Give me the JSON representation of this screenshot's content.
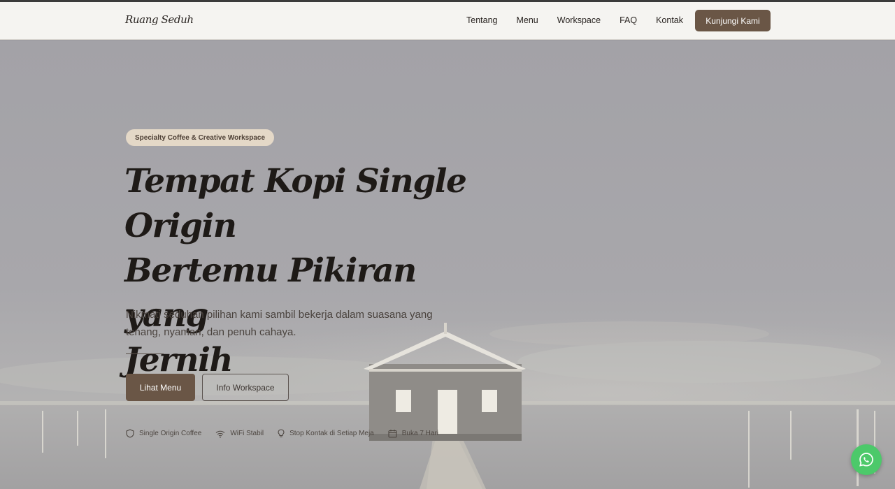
{
  "brand": "Ruang Seduh",
  "nav": {
    "items": [
      "Tentang",
      "Menu",
      "Workspace",
      "FAQ",
      "Kontak"
    ],
    "cta_label": "Kunjungi Kami"
  },
  "hero": {
    "badge": "Specialty Coffee & Creative Workspace",
    "title_lines": [
      "Tempat Kopi Single Origin",
      "Bertemu Pikiran yang",
      "Jernih"
    ],
    "subtitle": "Nikmati seduhan pilihan kami sambil bekerja dalam suasana yang tenang, nyaman, dan penuh cahaya.",
    "primary_button": "Lihat Menu",
    "secondary_button": "Info Workspace",
    "features": [
      {
        "icon": "shield-icon",
        "label": "Single Origin Coffee"
      },
      {
        "icon": "wifi-icon",
        "label": "WiFi Stabil"
      },
      {
        "icon": "lightbulb-icon",
        "label": "Stop Kontak di Setiap Meja"
      },
      {
        "icon": "calendar-icon",
        "label": "Buka 7 Hari"
      }
    ]
  },
  "floating": {
    "icon": "whatsapp-icon"
  },
  "colors": {
    "accent": "#6a5646",
    "badge_bg": "#e4d8c7",
    "header_bg": "#f5f4f1",
    "whatsapp": "#4cc96a"
  }
}
